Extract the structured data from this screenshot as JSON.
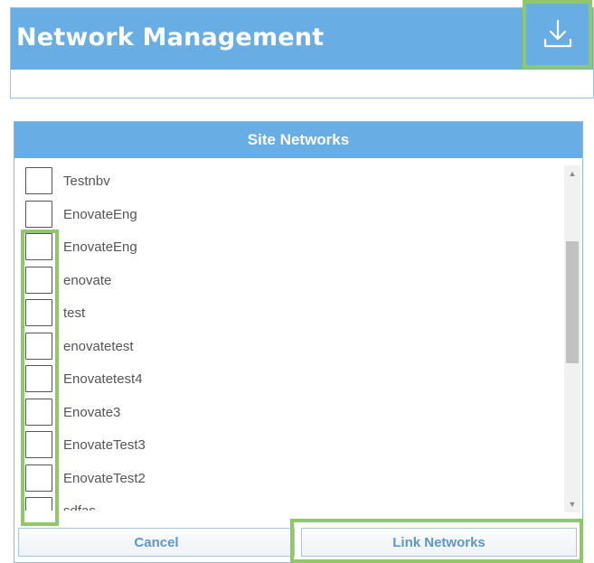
{
  "header": {
    "title": "Network Management",
    "download_icon": "download-icon"
  },
  "dialog": {
    "title": "Site Networks",
    "items": [
      {
        "label": "Testnbv",
        "checked": false
      },
      {
        "label": "EnovateEng",
        "checked": false
      },
      {
        "label": "EnovateEng",
        "checked": false
      },
      {
        "label": "enovate",
        "checked": false
      },
      {
        "label": "test",
        "checked": false
      },
      {
        "label": "enovatetest",
        "checked": false
      },
      {
        "label": "Enovatetest4",
        "checked": false
      },
      {
        "label": "Enovate3",
        "checked": false
      },
      {
        "label": "EnovateTest3",
        "checked": false
      },
      {
        "label": "EnovateTest2",
        "checked": false
      },
      {
        "label": "sdfas",
        "checked": false
      }
    ],
    "scroll_up_icon": "chevron-up-icon",
    "scroll_down_icon": "chevron-down-icon"
  },
  "footer": {
    "cancel_label": "Cancel",
    "link_label": "Link Networks"
  },
  "colors": {
    "header_blue": "#68ade4",
    "highlight_green": "#90c76a",
    "button_text": "#5d96c9"
  }
}
